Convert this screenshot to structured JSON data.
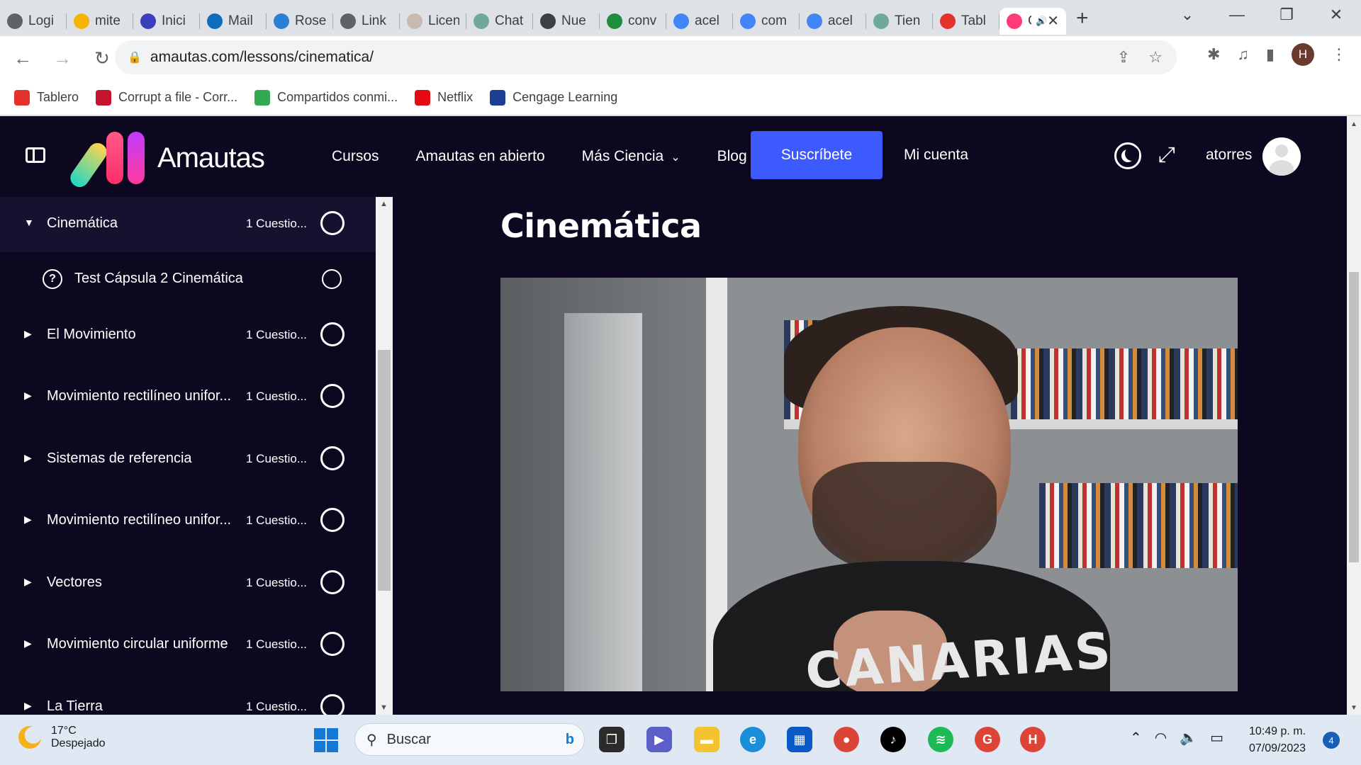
{
  "browser": {
    "tabs": [
      {
        "label": "Logi",
        "icon": "globe-icon",
        "color": "#5f6368"
      },
      {
        "label": "mite",
        "icon": "chart-icon",
        "color": "#f4b400"
      },
      {
        "label": "Inici",
        "icon": "atom-icon",
        "color": "#3a3fbf"
      },
      {
        "label": "Mail",
        "icon": "outlook-icon",
        "color": "#0f6cbd"
      },
      {
        "label": "Rose",
        "icon": "feather-icon",
        "color": "#2a7fd4"
      },
      {
        "label": "Link",
        "icon": "globe-icon",
        "color": "#5f6368"
      },
      {
        "label": "Licen",
        "icon": "sail-icon",
        "color": "#c9b9b0"
      },
      {
        "label": "Chat",
        "icon": "openai-icon",
        "color": "#6fa99b"
      },
      {
        "label": "Nue",
        "icon": "chrome-icon",
        "color": "#3c4043"
      },
      {
        "label": "conv",
        "icon": "plus-sheet-icon",
        "color": "#1e8e3e"
      },
      {
        "label": "acel",
        "icon": "google-icon",
        "color": "#4285f4"
      },
      {
        "label": "com",
        "icon": "google-icon",
        "color": "#4285f4"
      },
      {
        "label": "acel",
        "icon": "google-icon",
        "color": "#4285f4"
      },
      {
        "label": "Tien",
        "icon": "openai-icon",
        "color": "#6fa99b"
      },
      {
        "label": "Tabl",
        "icon": "canvas-icon",
        "color": "#e4312b"
      },
      {
        "label": "Ci",
        "icon": "amautas-icon",
        "color": "#ff3b78",
        "active": true
      }
    ],
    "address": "amautas.com/lessons/cinematica/",
    "profile_initial": "H",
    "bookmarks": [
      {
        "label": "Tablero",
        "color": "#e4312b"
      },
      {
        "label": "Corrupt a file - Corr...",
        "color": "#c4122f"
      },
      {
        "label": "Compartidos conmi...",
        "color": "#34a853"
      },
      {
        "label": "Netflix",
        "color": "#e50914"
      },
      {
        "label": "Cengage Learning",
        "color": "#1c3f94"
      }
    ]
  },
  "site": {
    "logo_text": "Amautas",
    "nav": [
      "Cursos",
      "Amautas en abierto",
      "Más Ciencia",
      "Blog"
    ],
    "subscribe": "Suscríbete",
    "account": "Mi cuenta",
    "username": "atorres",
    "accent": "#3d5afe",
    "background": "#0d0720"
  },
  "sidebar": {
    "items": [
      {
        "title": "Cinemática",
        "count": "1 Cuestio...",
        "expanded": true
      },
      {
        "title": "Test Cápsula 2 Cinemática",
        "sub": true
      },
      {
        "title": "El Movimiento",
        "count": "1 Cuestio..."
      },
      {
        "title": "Movimiento rectilíneo unifor...",
        "count": "1 Cuestio..."
      },
      {
        "title": "Sistemas de referencia",
        "count": "1 Cuestio..."
      },
      {
        "title": "Movimiento rectilíneo unifor...",
        "count": "1 Cuestio..."
      },
      {
        "title": "Vectores",
        "count": "1 Cuestio..."
      },
      {
        "title": "Movimiento circular uniforme",
        "count": "1 Cuestio..."
      },
      {
        "title": "La Tierra",
        "count": "1 Cuestio..."
      }
    ]
  },
  "lesson": {
    "title": "Cinemática",
    "video_shirt_text": "CANARIAS"
  },
  "taskbar": {
    "temperature": "17°C",
    "weather": "Despejado",
    "search": "Buscar",
    "time": "10:49 p. m.",
    "date": "07/09/2023",
    "notifications": "4"
  }
}
